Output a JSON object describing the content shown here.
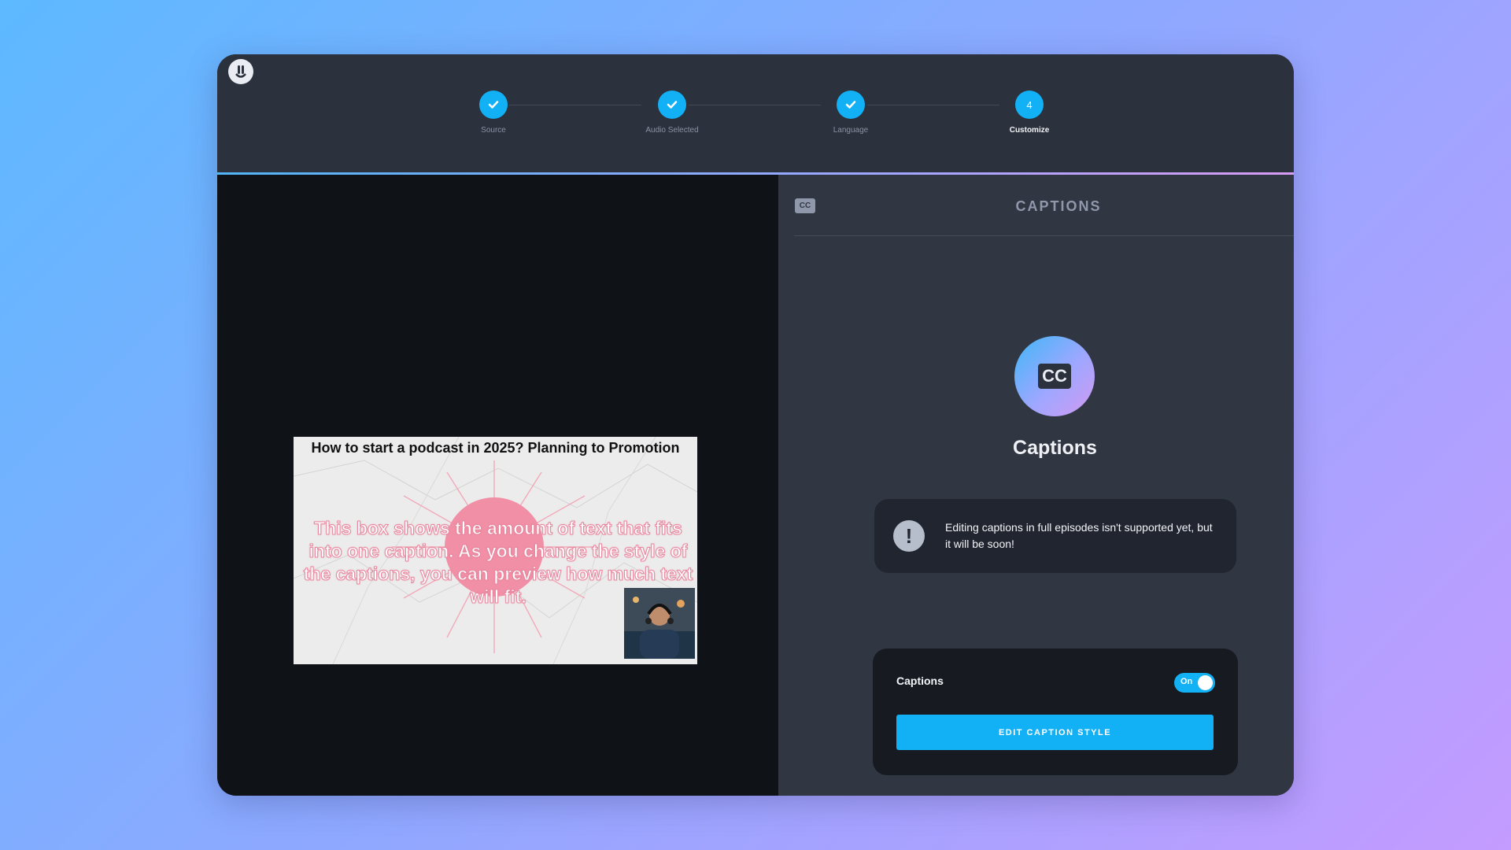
{
  "app": {
    "logo_icon": "fish-face-logo-icon",
    "steps": [
      {
        "label": "Source",
        "state": "complete",
        "icon": "check-icon"
      },
      {
        "label": "Audio Selected",
        "state": "complete",
        "icon": "check-icon"
      },
      {
        "label": "Language",
        "state": "complete",
        "icon": "check-icon"
      },
      {
        "label": "Customize",
        "state": "active",
        "number": "4"
      }
    ]
  },
  "preview": {
    "title": "How to start a podcast in 2025? Planning to Promotion",
    "caption": "This box shows the amount of text that fits into one caption. As you change the style of the captions, you can preview how much text will fit.",
    "thumbnail_icon": "host-thumbnail"
  },
  "captions_panel": {
    "header": "CAPTIONS",
    "header_icon": "closed-captions-icon",
    "hero_icon_text": "CC",
    "title": "Captions",
    "notice": "Editing captions in full episodes isn't supported yet, but it will be soon!",
    "toggle_label": "Captions",
    "toggle_state": "On",
    "edit_button": "EDIT CAPTION STYLE"
  },
  "colors": {
    "accent": "#12b0f5",
    "panel": "#313643",
    "dark": "#171b21"
  }
}
